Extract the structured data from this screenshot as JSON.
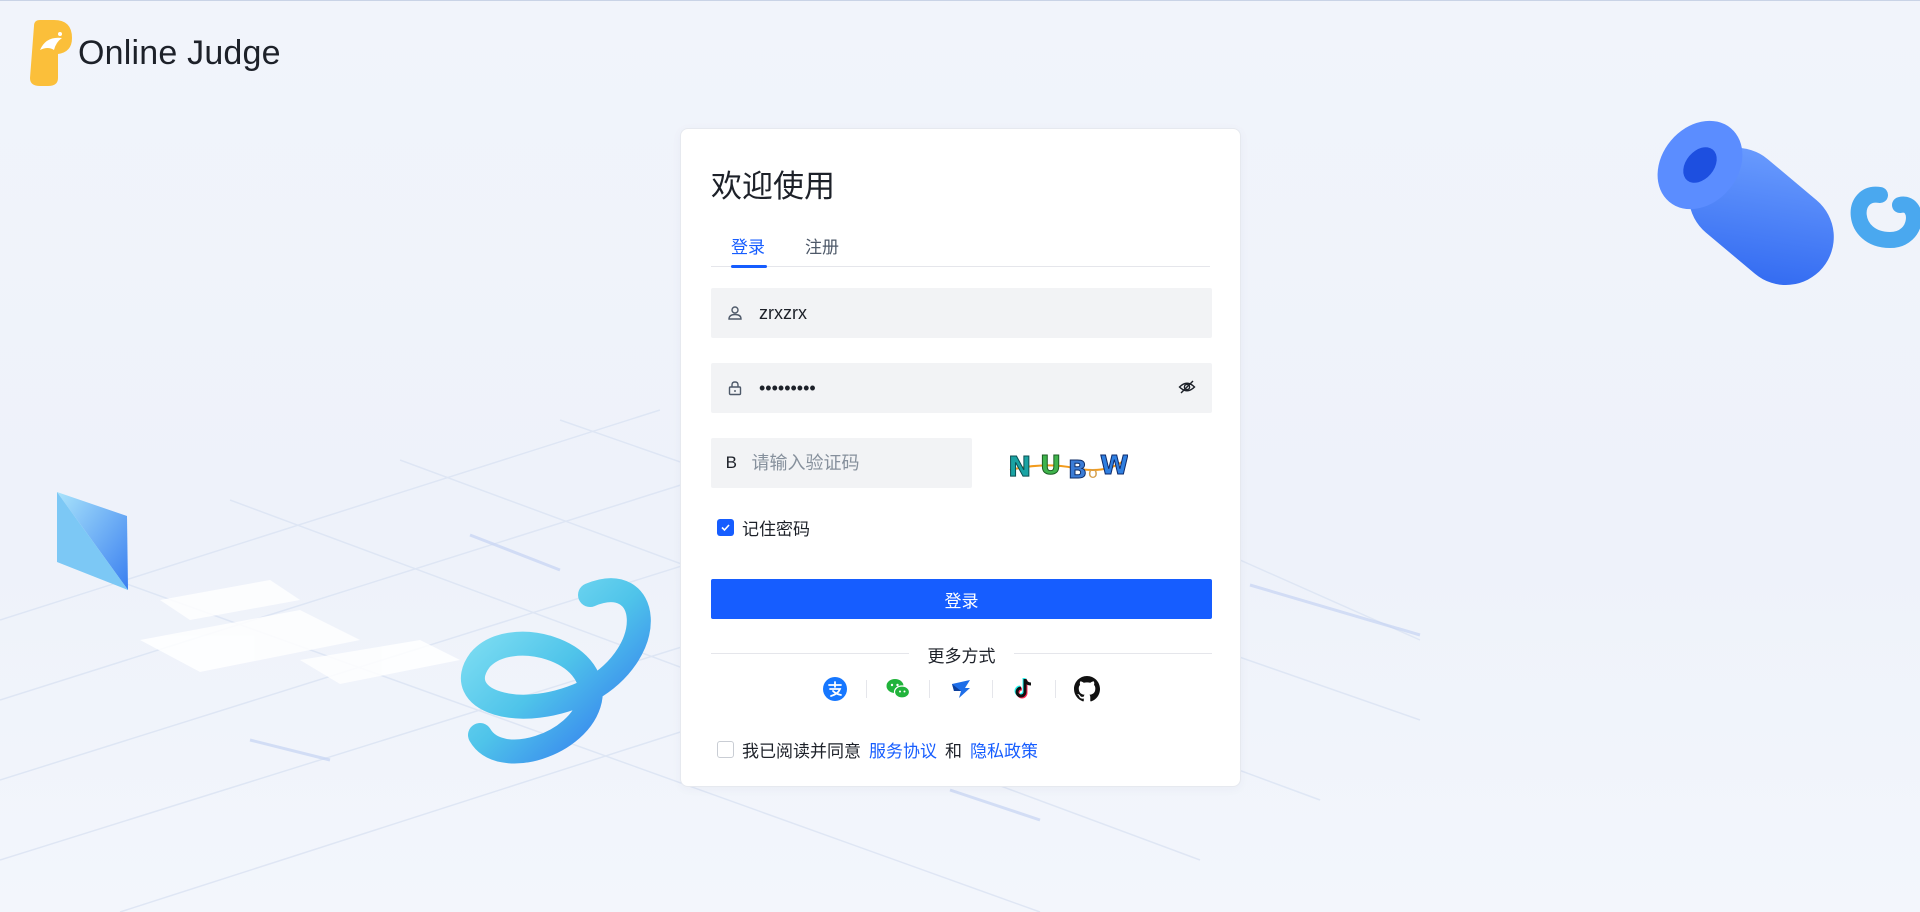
{
  "app": {
    "name": "Online Judge"
  },
  "card": {
    "title": "欢迎使用",
    "tabs": [
      {
        "label": "登录",
        "active": true
      },
      {
        "label": "注册",
        "active": false
      }
    ],
    "username": {
      "value": "zrxzrx",
      "icon": "user-icon"
    },
    "password": {
      "value": "•••••••••",
      "icon": "lock-icon",
      "toggle_icon": "eye-off-icon"
    },
    "captcha": {
      "placeholder": "请输入验证码",
      "prefix": "B",
      "image_text": "NUBoW"
    },
    "remember": {
      "label": "记住密码",
      "checked": true
    },
    "login_button": "登录",
    "more_methods": "更多方式",
    "social": [
      "alipay-icon",
      "wechat-icon",
      "dingtalk-icon",
      "douyin-icon",
      "github-icon"
    ],
    "agreement": {
      "prefix": "我已阅读并同意",
      "terms": "服务协议",
      "and": "和",
      "privacy": "隐私政策",
      "checked": false
    }
  },
  "colors": {
    "primary": "#165dff",
    "field_bg": "#f2f3f5",
    "logo": "#fbbf3a"
  }
}
